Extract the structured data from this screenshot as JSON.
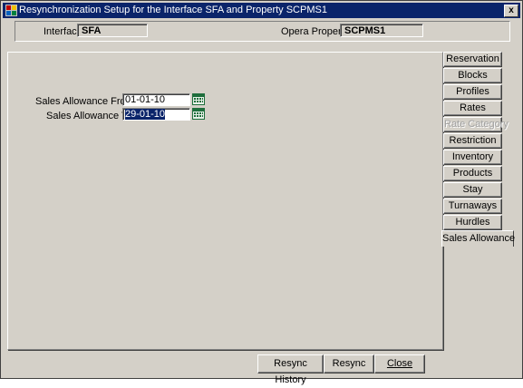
{
  "window": {
    "title": "Resynchronization Setup for the Interface SFA and Property SCPMS1",
    "close_glyph": "x"
  },
  "header": {
    "interface_label": "Interface",
    "interface_value": "SFA",
    "property_label": "Opera Property",
    "property_value": "SCPMS1"
  },
  "form": {
    "from_label": "Sales Allowance From",
    "from_value": "01-01-10",
    "to_label": "Sales Allowance To",
    "to_value": "29-01-10"
  },
  "tabs": [
    {
      "label": "Reservation",
      "state": "normal"
    },
    {
      "label": "Blocks",
      "state": "normal"
    },
    {
      "label": "Profiles",
      "state": "normal"
    },
    {
      "label": "Rates",
      "state": "normal"
    },
    {
      "label": "Rate Category",
      "state": "disabled"
    },
    {
      "label": "Restriction",
      "state": "normal"
    },
    {
      "label": "Inventory",
      "state": "normal"
    },
    {
      "label": "Products",
      "state": "normal"
    },
    {
      "label": "Stay",
      "state": "normal"
    },
    {
      "label": "Turnaways",
      "state": "normal"
    },
    {
      "label": "Hurdles",
      "state": "normal"
    },
    {
      "label": "Sales Allowance",
      "state": "active"
    }
  ],
  "buttons": {
    "resync_history": "Resync History",
    "resync": "Resync",
    "close": "Close"
  },
  "colors": {
    "titlebar": "#0a246a",
    "face": "#d4d0c8",
    "selection": "#0a246a",
    "calendar_icon": "#1e6e3c"
  },
  "icons": {
    "title_icon": "app-icon",
    "calendar": "calendar-icon"
  }
}
